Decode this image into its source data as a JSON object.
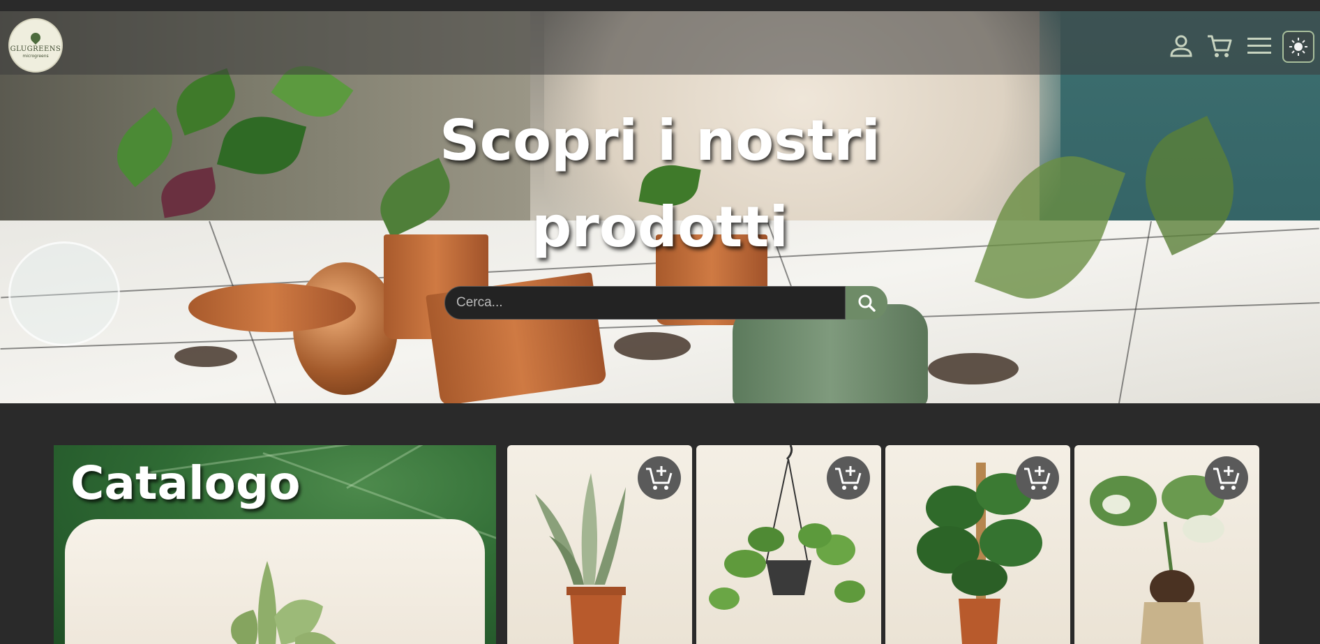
{
  "brand": {
    "logo_name": "GLUGREENS",
    "logo_sub": "microgreens"
  },
  "nav": {
    "icons": [
      "user-icon",
      "cart-icon",
      "menu-icon",
      "sun-icon"
    ]
  },
  "hero": {
    "title_line1": "Scopri i nostri",
    "title_line2": "prodotti"
  },
  "search": {
    "placeholder": "Cerca...",
    "button_icon": "search-icon"
  },
  "catalog": {
    "title": "Catalogo"
  },
  "products": [
    {
      "icon": "add-to-cart-icon",
      "image": "snake-plant"
    },
    {
      "icon": "add-to-cart-icon",
      "image": "hanging-pothos"
    },
    {
      "icon": "add-to-cart-icon",
      "image": "monstera-moss-pole"
    },
    {
      "icon": "add-to-cart-icon",
      "image": "monstera-variegata"
    }
  ],
  "colors": {
    "background": "#2a2a2a",
    "accent": "#6e8b67",
    "card": "#f4efe5",
    "button_dark": "#5a5a5a"
  }
}
